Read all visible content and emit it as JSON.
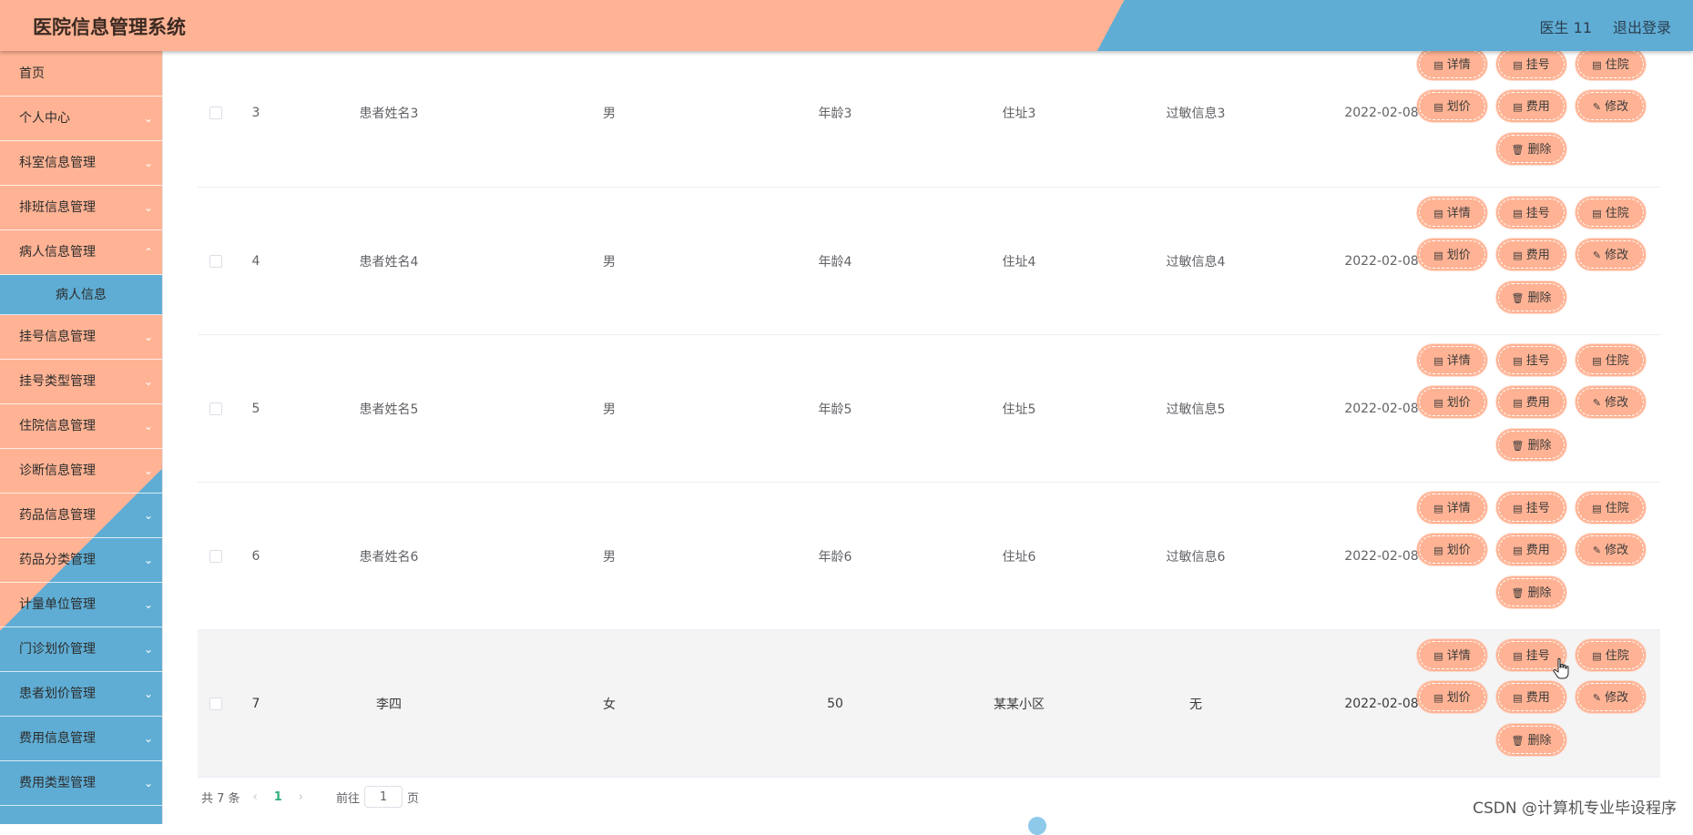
{
  "header": {
    "title": "医院信息管理系统",
    "user": "医生 11",
    "logout": "退出登录"
  },
  "sidebar": {
    "items": [
      {
        "label": "首页",
        "chevron": false
      },
      {
        "label": "个人中心",
        "chevron": true
      },
      {
        "label": "科室信息管理",
        "chevron": true
      },
      {
        "label": "排班信息管理",
        "chevron": true
      },
      {
        "label": "病人信息管理",
        "chevron": true
      },
      {
        "label": "挂号信息管理",
        "chevron": true
      },
      {
        "label": "挂号类型管理",
        "chevron": true
      },
      {
        "label": "住院信息管理",
        "chevron": true
      },
      {
        "label": "诊断信息管理",
        "chevron": true
      },
      {
        "label": "药品信息管理",
        "chevron": true
      },
      {
        "label": "药品分类管理",
        "chevron": true
      },
      {
        "label": "计量单位管理",
        "chevron": true
      },
      {
        "label": "门诊划价管理",
        "chevron": true
      },
      {
        "label": "患者划价管理",
        "chevron": true
      },
      {
        "label": "费用信息管理",
        "chevron": true
      },
      {
        "label": "费用类型管理",
        "chevron": true
      }
    ],
    "submenu": {
      "label": "病人信息"
    }
  },
  "table": {
    "rows": [
      {
        "index": "3",
        "name": "患者姓名3",
        "sex": "男",
        "age": "年龄3",
        "address": "住址3",
        "allergy": "过敏信息3",
        "date": "2022-02-08"
      },
      {
        "index": "4",
        "name": "患者姓名4",
        "sex": "男",
        "age": "年龄4",
        "address": "住址4",
        "allergy": "过敏信息4",
        "date": "2022-02-08"
      },
      {
        "index": "5",
        "name": "患者姓名5",
        "sex": "男",
        "age": "年龄5",
        "address": "住址5",
        "allergy": "过敏信息5",
        "date": "2022-02-08"
      },
      {
        "index": "6",
        "name": "患者姓名6",
        "sex": "男",
        "age": "年龄6",
        "address": "住址6",
        "allergy": "过敏信息6",
        "date": "2022-02-08"
      },
      {
        "index": "7",
        "name": "李四",
        "sex": "女",
        "age": "50",
        "address": "某某小区",
        "allergy": "无",
        "date": "2022-02-08"
      }
    ],
    "actions": {
      "detail": "详情",
      "register": "挂号",
      "hospitalize": "住院",
      "price": "划价",
      "fee": "费用",
      "edit": "修改",
      "delete": "删除"
    },
    "action_icons": {
      "detail": "document-icon",
      "register": "document-icon",
      "hospitalize": "document-icon",
      "price": "document-icon",
      "fee": "document-icon",
      "edit": "edit-icon",
      "delete": "trash-icon"
    }
  },
  "pagination": {
    "total": "共 7 条",
    "current_page": "1",
    "goto_prefix": "前往",
    "goto_value": "1",
    "goto_suffix": "页"
  },
  "watermark": "CSDN @计算机专业毕设程序",
  "colors": {
    "accent_orange": "#ffb394",
    "accent_blue": "#5fadd4",
    "page_active": "#2fae7c"
  }
}
